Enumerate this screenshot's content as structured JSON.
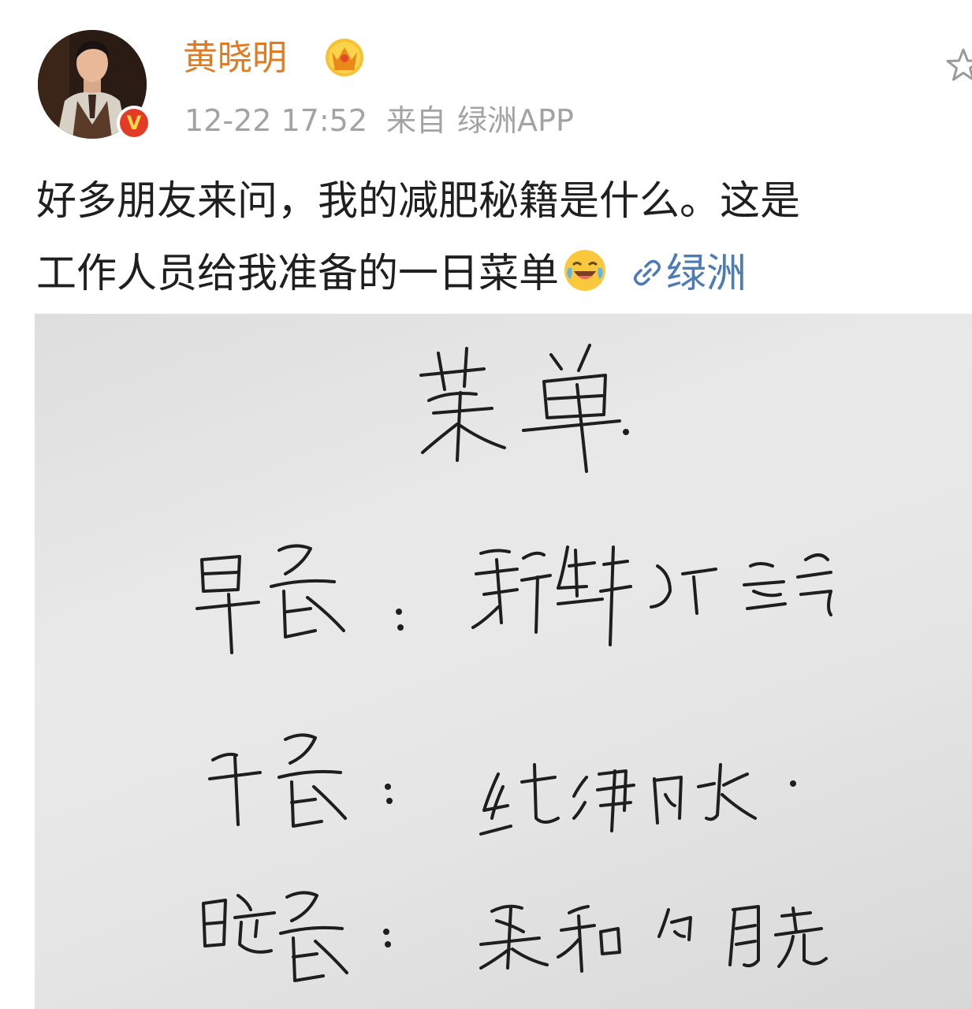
{
  "post": {
    "username": "黄晓明",
    "verified_badge": "V",
    "timestamp": "12-22 17:52",
    "source_label": "来自",
    "source_app": "绿洲APP",
    "text_line1": "好多朋友来问，我的减肥秘籍是什么。这是",
    "text_line2": "工作人员给我准备的一日菜单",
    "link_text": "绿洲"
  },
  "icons": {
    "crown": "crown-icon",
    "favorite": "star-icon",
    "emoji": "laughing-crying-emoji-icon",
    "link": "link-icon"
  },
  "handwritten_menu": {
    "title": "菜单",
    "rows": [
      {
        "meal": "早餐",
        "item": "新鲜的空气"
      },
      {
        "meal": "午餐",
        "item": "纯净的水"
      },
      {
        "meal": "晚餐",
        "item": "柔和的月光"
      }
    ]
  },
  "colors": {
    "username": "#e07b22",
    "meta": "#a3a3a3",
    "link": "#4c7bb5",
    "badge": "#e23b27"
  }
}
